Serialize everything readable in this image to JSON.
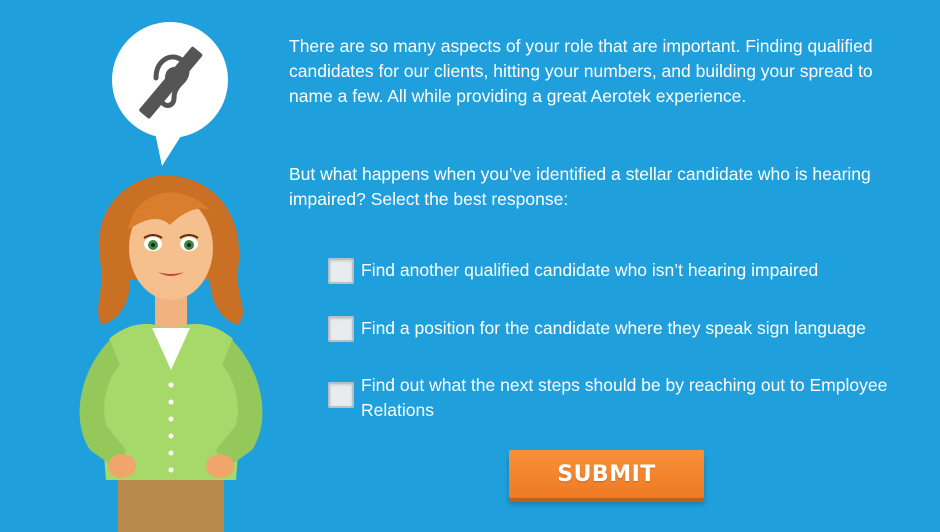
{
  "intro_text": "There are so many aspects of your role that are important. Finding qualified candidates for our clients, hitting your numbers, and building your spread to name a few. All while providing a great Aerotek experience.",
  "question_text": "But what happens when you’ve identified a stellar candidate who is hearing impaired? Select the best response:",
  "options": [
    {
      "label": "Find another qualified candidate who isn’t hearing impaired",
      "checked": false
    },
    {
      "label": "Find a position for the candidate where they speak sign language",
      "checked": false
    },
    {
      "label": "Find out what the next steps should be by reaching out to Employee Relations",
      "checked": false
    }
  ],
  "submit_label": "SUBMIT",
  "icons": {
    "bubble": "hearing-impaired-icon"
  },
  "colors": {
    "background": "#1fa0dc",
    "submit": "#f28530",
    "text": "#ffffff"
  }
}
